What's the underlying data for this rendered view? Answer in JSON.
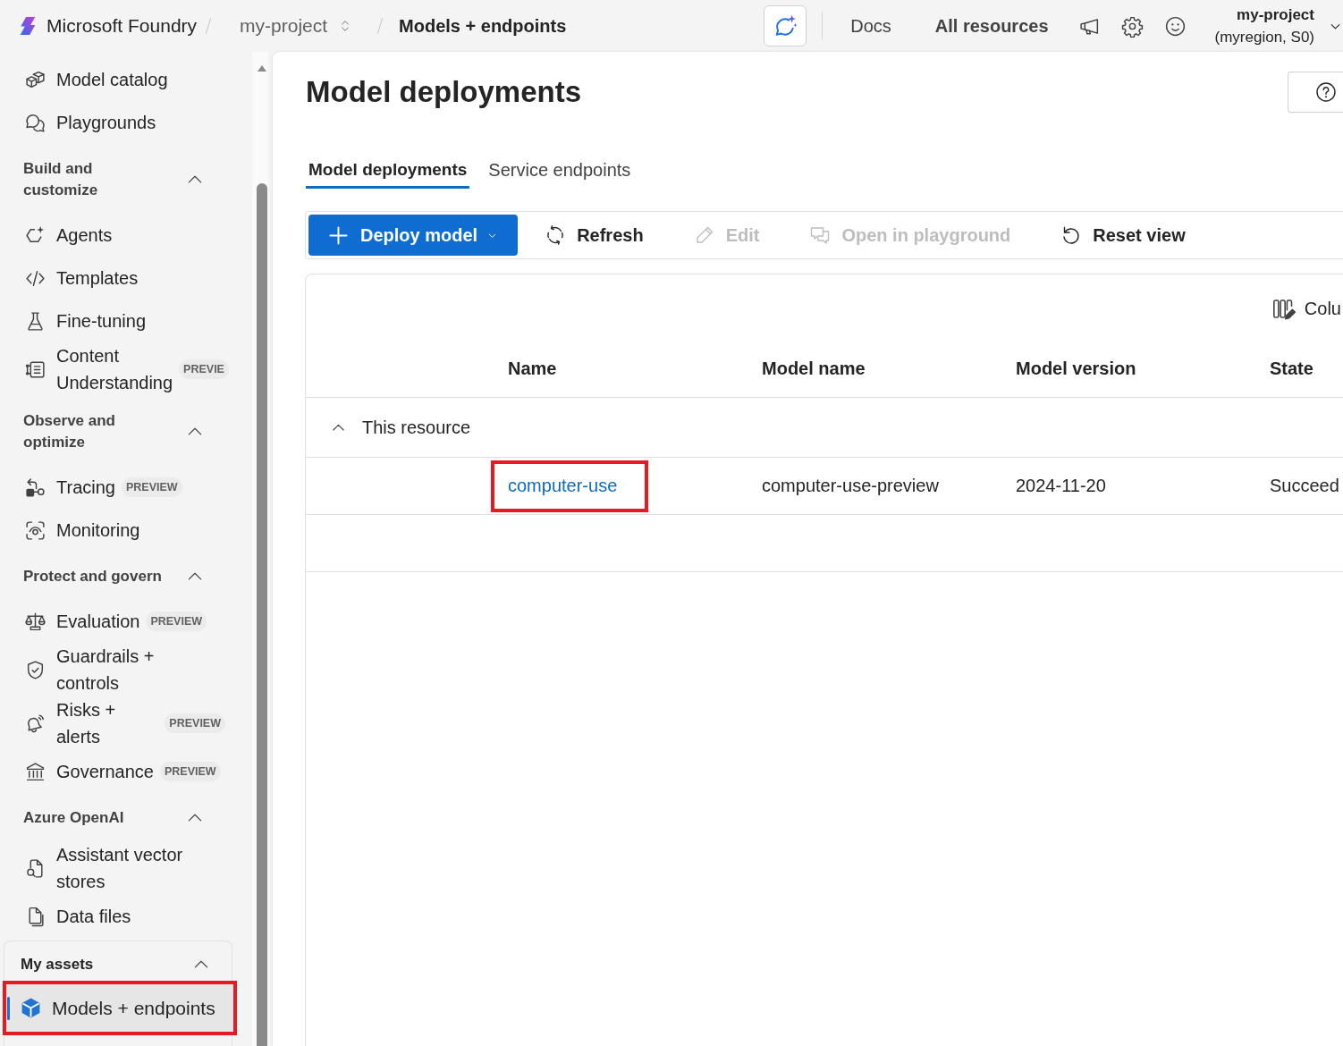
{
  "top_bar": {
    "app_name": "Microsoft Foundry",
    "project": "my-project",
    "current_page": "Models + endpoints",
    "links": [
      {
        "label": "Docs",
        "kind": "link"
      },
      {
        "label": "All resources",
        "kind": "button"
      }
    ],
    "account": {
      "name": "my-project",
      "detail": "(myregion, S0)"
    }
  },
  "sidebar": {
    "items": [
      {
        "label": "Model catalog",
        "selected": false,
        "highlighted": false
      },
      {
        "label": "Playgrounds",
        "selected": false,
        "highlighted": false
      }
    ],
    "sections": [
      {
        "title": "Build and customize",
        "expanded": true,
        "items": [
          {
            "label": "Agents",
            "selected": false,
            "highlighted": false
          },
          {
            "label": "Templates",
            "selected": false,
            "highlighted": false
          },
          {
            "label": "Fine-tuning",
            "selected": false,
            "highlighted": false
          },
          {
            "label": "Content Understanding",
            "badge": "PREVIE",
            "selected": false,
            "highlighted": false
          }
        ]
      },
      {
        "title": "Observe and optimize",
        "expanded": true,
        "items": [
          {
            "label": "Tracing",
            "badge": "PREVIEW",
            "selected": false,
            "highlighted": false
          },
          {
            "label": "Monitoring",
            "selected": false,
            "highlighted": false
          }
        ]
      },
      {
        "title": "Protect and govern",
        "expanded": true,
        "items": [
          {
            "label": "Evaluation",
            "badge": "PREVIEW",
            "selected": false,
            "highlighted": false
          },
          {
            "label": "Guardrails + controls",
            "selected": false,
            "highlighted": false
          },
          {
            "label": "Risks + alerts",
            "badge": "PREVIEW",
            "selected": false,
            "highlighted": false
          },
          {
            "label": "Governance",
            "badge": "PREVIEW",
            "selected": false,
            "highlighted": false
          }
        ]
      },
      {
        "title": "Azure OpenAI",
        "expanded": true,
        "items": [
          {
            "label": "Assistant vector stores",
            "selected": false,
            "highlighted": false
          },
          {
            "label": "Data files",
            "selected": false,
            "highlighted": false
          }
        ]
      }
    ],
    "my_assets": {
      "title": "My assets",
      "expanded": true,
      "items": [
        {
          "label": "Models + endpoints",
          "selected": true,
          "highlighted": true
        }
      ]
    }
  },
  "page": {
    "title": "Model deployments",
    "tabs": [
      {
        "label": "Model deployments",
        "selected": true
      },
      {
        "label": "Service endpoints",
        "selected": false
      }
    ],
    "toolbar": [
      {
        "label": "Deploy model",
        "kind": "primary",
        "disabled": false
      },
      {
        "label": "Refresh",
        "kind": "action",
        "disabled": false
      },
      {
        "label": "Edit",
        "kind": "action",
        "disabled": true
      },
      {
        "label": "Open in playground",
        "kind": "action",
        "disabled": true
      },
      {
        "label": "Reset view",
        "kind": "action",
        "disabled": false
      }
    ],
    "table": {
      "columns_button": "Colu",
      "columns": [
        "Name",
        "Model name",
        "Model version",
        "State"
      ],
      "groups": [
        {
          "label": "This resource",
          "expanded": true,
          "rows": [
            {
              "cells": [
                "computer-use",
                "computer-use-preview",
                "2024-11-20",
                "Succeed"
              ],
              "highlighted": true
            }
          ]
        }
      ]
    }
  }
}
